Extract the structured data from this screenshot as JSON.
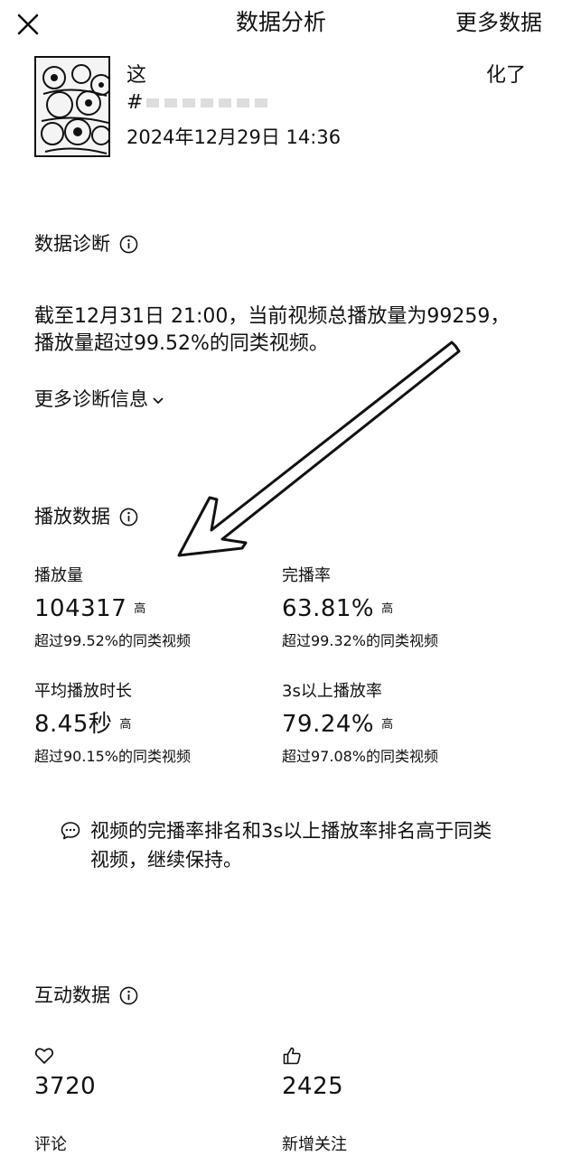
{
  "header": {
    "title": "数据分析",
    "more_label": "更多数据"
  },
  "video": {
    "title_start": "这",
    "title_end": "化了",
    "tag_prefix": "#",
    "date": "2024年12月29日 14:36"
  },
  "diagnosis": {
    "heading": "数据诊断",
    "line1": "截至12月31日 21:00，当前视频总播放量为99259，",
    "line2": "播放量超过99.52%的同类视频。",
    "more_label": "更多诊断信息"
  },
  "playback": {
    "heading": "播放数据",
    "metrics": [
      {
        "label": "播放量",
        "value": "104317",
        "level": "高",
        "compare": "超过99.52%的同类视频"
      },
      {
        "label": "完播率",
        "value": "63.81%",
        "level": "高",
        "compare": "超过99.32%的同类视频"
      },
      {
        "label": "平均播放时长",
        "value": "8.45秒",
        "level": "高",
        "compare": "超过90.15%的同类视频"
      },
      {
        "label": "3s以上播放率",
        "value": "79.24%",
        "level": "高",
        "compare": "超过97.08%的同类视频"
      }
    ],
    "tip_line1": "视频的完播率排名和3s以上播放率排名高于同类",
    "tip_line2": "视频，继续保持。"
  },
  "interaction": {
    "heading": "互动数据",
    "likes_value": "3720",
    "thumbs_value": "2425",
    "comments_label": "评论",
    "follows_label": "新增关注"
  }
}
